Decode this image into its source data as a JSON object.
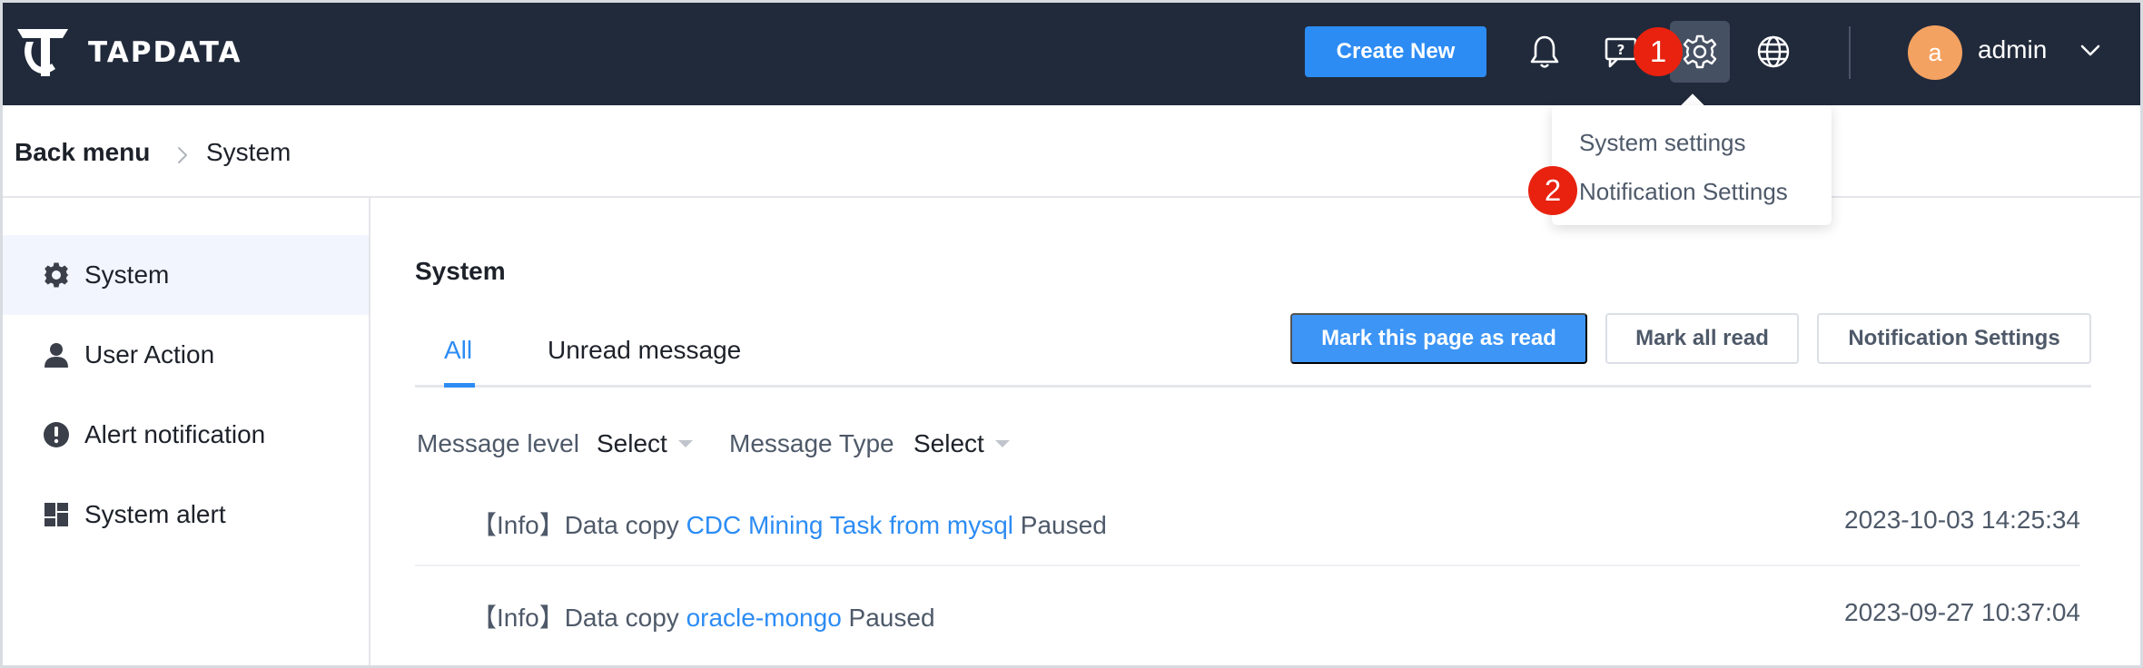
{
  "header": {
    "brand": "TAPDATA",
    "create_label": "Create New",
    "user": {
      "avatar_letter": "a",
      "name": "admin"
    }
  },
  "annotations": {
    "badge1": "1",
    "badge2": "2"
  },
  "settings_menu": {
    "items": [
      "System settings",
      "Notification Settings"
    ]
  },
  "breadcrumb": {
    "back": "Back menu",
    "current": "System"
  },
  "sidebar": {
    "items": [
      {
        "label": "System",
        "icon": "gear-icon"
      },
      {
        "label": "User Action",
        "icon": "user-icon"
      },
      {
        "label": "Alert notification",
        "icon": "alert-icon"
      },
      {
        "label": "System alert",
        "icon": "dashboard-icon"
      }
    ]
  },
  "main": {
    "title": "System",
    "tabs": [
      "All",
      "Unread message"
    ],
    "actions": {
      "mark_page": "Mark this page as read",
      "mark_all": "Mark all read",
      "notification_settings": "Notification Settings"
    },
    "filters": {
      "level_label": "Message level",
      "level_value": "Select",
      "type_label": "Message Type",
      "type_value": "Select"
    },
    "messages": [
      {
        "prefix": "【Info】Data copy",
        "link": "CDC Mining Task from mysql",
        "suffix": "Paused",
        "time": "2023-10-03 14:25:34"
      },
      {
        "prefix": "【Info】Data copy",
        "link": "oracle-mongo",
        "suffix": "Paused",
        "time": "2023-09-27 10:37:04"
      }
    ]
  },
  "colors": {
    "topbar": "#212a3b",
    "accent": "#2c8cf4",
    "badge": "#e8220f",
    "avatar": "#f4a261"
  }
}
